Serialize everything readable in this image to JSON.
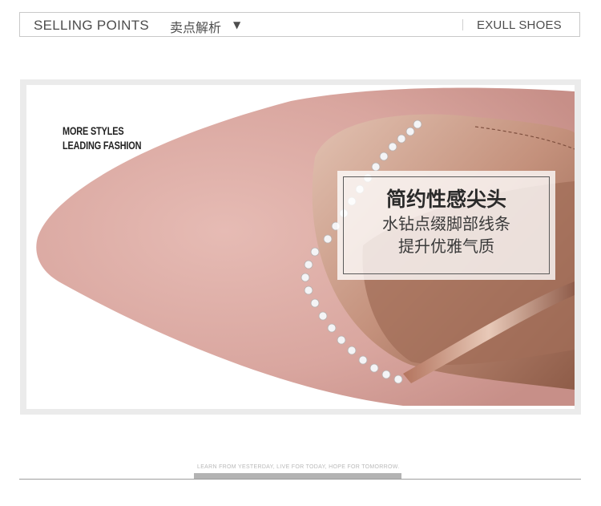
{
  "header": {
    "title_en": "SELLING POINTS",
    "title_cn": "卖点解析",
    "caret": "▼",
    "brand": "EXULL SHOES"
  },
  "photo": {
    "slogan": [
      "MORE STYLES",
      "LEADING FASHION"
    ],
    "subject": "pink-suede-pointed-toe-shoe-with-rhinestone-trim",
    "colors": {
      "suede": "#dcaaa3",
      "suede_shadow": "#c98f88",
      "lining": "#c0907a",
      "lining_dark": "#9c6a55",
      "rhinestone": "#f2f2f4"
    }
  },
  "caption": {
    "title": "简约性感尖头",
    "lines": [
      "水钻点缀脚部线条",
      "提升优雅气质"
    ]
  },
  "footer": {
    "tagline": "LEARN FROM YESTERDAY, LIVE FOR TODAY, HOPE FOR TOMORROW."
  }
}
